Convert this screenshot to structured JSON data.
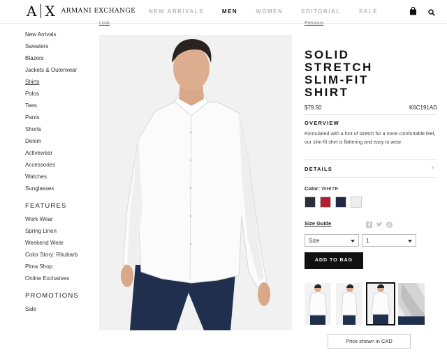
{
  "header": {
    "logo_mark_left": "A",
    "logo_mark_right": "X",
    "brand": "ARMANI EXCHANGE",
    "nav": [
      "NEW ARRIVALS",
      "MEN",
      "WOMEN",
      "EDITORIAL",
      "SALE"
    ],
    "active_nav": "MEN"
  },
  "sidebar": {
    "categories": [
      "New Arrivals",
      "Sweaters",
      "Blazers",
      "Jackets & Outerwear",
      "Shirts",
      "Polos",
      "Tees",
      "Pants",
      "Shorts",
      "Denim",
      "Activewear",
      "Accessories",
      "Watches",
      "Sunglasses"
    ],
    "features_heading": "FEATURES",
    "features": [
      "Work Wear",
      "Spring Linen",
      "Weekend Wear",
      "Color Story: Rhubarb",
      "Pima Shop",
      "Online Exclusives"
    ],
    "promotions_heading": "PROMOTIONS",
    "promotions": [
      "Sale"
    ]
  },
  "breadcrumb": {
    "left": "Look",
    "right": "Previous"
  },
  "product": {
    "title_lines": [
      "SOLID",
      "STRETCH",
      "SLIM-FIT",
      "SHIRT"
    ],
    "price": "$79.50",
    "sku": "K6C191AD",
    "overview_heading": "OVERVIEW",
    "overview_text": "Formulated with a hint of stretch for a more comfortable feel, our slim-fit shirt is flattering and easy to wear.",
    "details_heading": "DETAILS",
    "details_toggle": "+",
    "color_label": "Color:",
    "color_value": "WHITE",
    "swatch_colors": [
      "#2d2f36",
      "#b01e2f",
      "#232845",
      "#eeeeee"
    ],
    "size_guide": "Size Guide",
    "size_select": "Size",
    "qty_select": "1",
    "add_to_bag": "ADD TO BAG",
    "price_note": "Price shown in CAD"
  },
  "icons": [
    "bag-icon",
    "search-icon",
    "facebook-icon",
    "twitter-icon",
    "pinterest-icon",
    "chevron-down-icon"
  ]
}
